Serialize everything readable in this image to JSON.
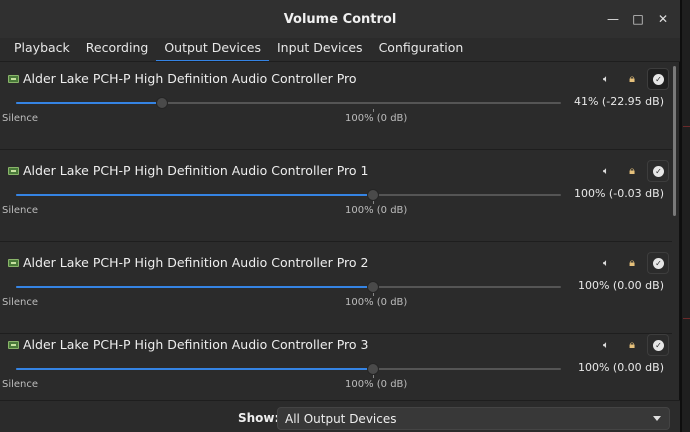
{
  "window": {
    "title": "Volume Control",
    "controls": {
      "minimize": "—",
      "maximize": "□",
      "close": "✕"
    }
  },
  "tabs": [
    {
      "label": "Playback",
      "active": false
    },
    {
      "label": "Recording",
      "active": false
    },
    {
      "label": "Output Devices",
      "active": true
    },
    {
      "label": "Input Devices",
      "active": false
    },
    {
      "label": "Configuration",
      "active": false
    }
  ],
  "icons": {
    "device": "sound-card-icon",
    "mute": "speaker-mute-icon",
    "lock": "lock-icon",
    "default": "checkmark-icon"
  },
  "colors": {
    "accent": "#3584e4",
    "lock": "#e5c07b"
  },
  "scale": {
    "min_label": "Silence",
    "ref_label": "100% (0 dB)"
  },
  "devices": [
    {
      "name": "Alder Lake PCH-P High Definition Audio Controller Pro",
      "volume_text": "41% (-22.95 dB)",
      "volume_fraction": 0.41,
      "default": true
    },
    {
      "name": "Alder Lake PCH-P High Definition Audio Controller Pro 1",
      "volume_text": "100% (-0.03 dB)",
      "volume_fraction": 1.0,
      "default": false
    },
    {
      "name": "Alder Lake PCH-P High Definition Audio Controller Pro 2",
      "volume_text": "100% (0.00 dB)",
      "volume_fraction": 1.0,
      "default": false
    },
    {
      "name": "Alder Lake PCH-P High Definition Audio Controller Pro 3",
      "volume_text": "100% (0.00 dB)",
      "volume_fraction": 1.0,
      "default": false
    }
  ],
  "footer": {
    "show_label": "Show:",
    "show_value": "All Output Devices"
  }
}
